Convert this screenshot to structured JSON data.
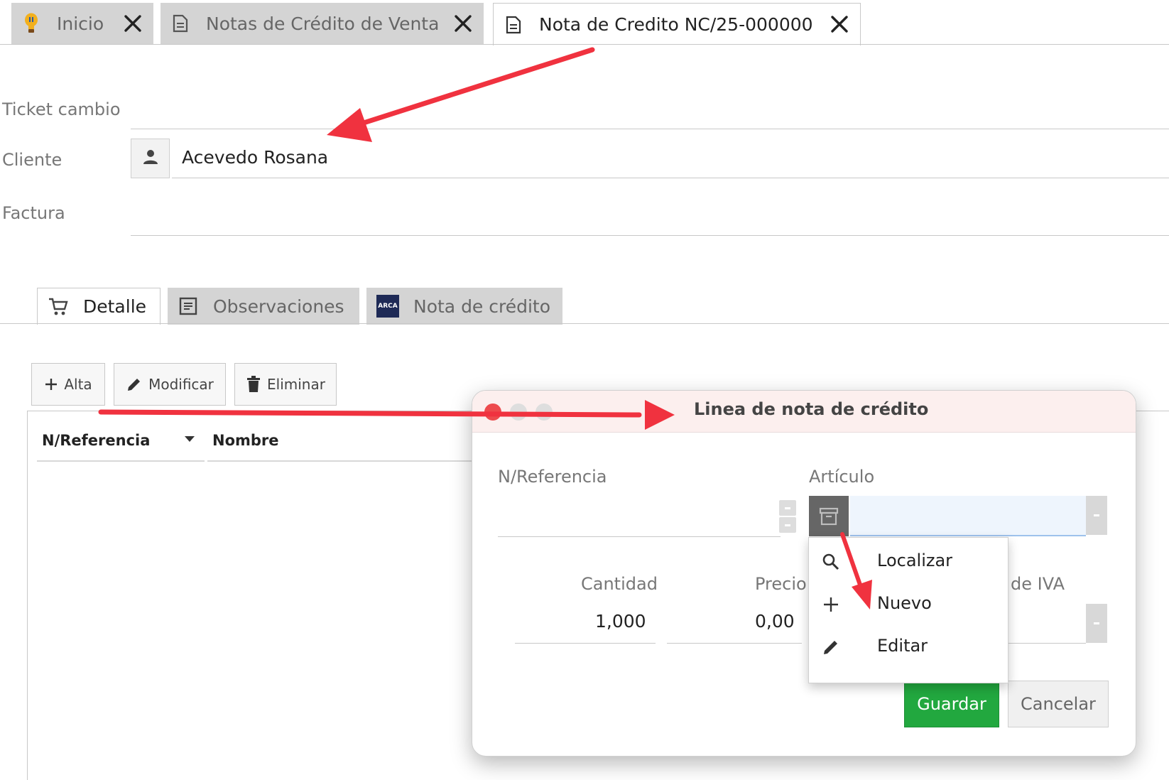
{
  "top_tabs": [
    {
      "label": "Inicio",
      "icon": "lightbulb-icon",
      "close_icon": "close-icon"
    },
    {
      "label": "Notas de Crédito de Venta",
      "icon": "document-icon",
      "close_icon": "close-icon"
    },
    {
      "label": "Nota de Credito NC/25-000000",
      "icon": "document-icon",
      "close_icon": "close-icon",
      "active": true
    }
  ],
  "form": {
    "ticket_label": "Ticket cambio",
    "cliente_label": "Cliente",
    "cliente_value": "Acevedo Rosana",
    "cliente_icon": "person-icon",
    "factura_label": "Factura"
  },
  "sub_tabs": [
    {
      "label": "Detalle",
      "icon": "cart-icon",
      "active": true
    },
    {
      "label": "Observaciones",
      "icon": "notes-icon"
    },
    {
      "label": "Nota de crédito",
      "icon": "arca-logo",
      "logo_text": "ARCA"
    }
  ],
  "toolbar": {
    "alta": "Alta",
    "modificar": "Modificar",
    "eliminar": "Eliminar"
  },
  "grid": {
    "columns": [
      "N/Referencia",
      "Nombre"
    ]
  },
  "dialog": {
    "title": "Linea de nota de crédito",
    "nref_label": "N/Referencia",
    "articulo_label": "Artículo",
    "cantidad_label": "Cantidad",
    "cantidad_value": "1,000",
    "precio_label": "Precio",
    "precio_value": "0,00",
    "iva_label": "de IVA",
    "guardar": "Guardar",
    "cancelar": "Cancelar"
  },
  "menu": {
    "items": [
      {
        "label": "Localizar",
        "icon": "search-icon"
      },
      {
        "label": "Nuevo",
        "icon": "plus-icon"
      },
      {
        "label": "Editar",
        "icon": "pencil-icon"
      }
    ]
  },
  "colors": {
    "accent_arrow": "#f0323f",
    "guardar_green": "#22a83f",
    "tab_inactive": "#d4d4d4",
    "dialog_title_bg": "#fcefee",
    "arca_navy": "#1e2a56"
  }
}
